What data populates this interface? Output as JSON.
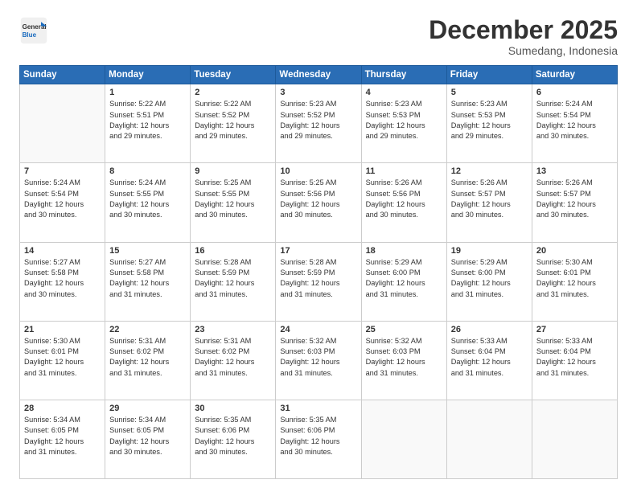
{
  "logo": {
    "line1": "General",
    "line2": "Blue"
  },
  "title": "December 2025",
  "subtitle": "Sumedang, Indonesia",
  "days_header": [
    "Sunday",
    "Monday",
    "Tuesday",
    "Wednesday",
    "Thursday",
    "Friday",
    "Saturday"
  ],
  "weeks": [
    [
      {
        "num": "",
        "info": ""
      },
      {
        "num": "1",
        "info": "Sunrise: 5:22 AM\nSunset: 5:51 PM\nDaylight: 12 hours\nand 29 minutes."
      },
      {
        "num": "2",
        "info": "Sunrise: 5:22 AM\nSunset: 5:52 PM\nDaylight: 12 hours\nand 29 minutes."
      },
      {
        "num": "3",
        "info": "Sunrise: 5:23 AM\nSunset: 5:52 PM\nDaylight: 12 hours\nand 29 minutes."
      },
      {
        "num": "4",
        "info": "Sunrise: 5:23 AM\nSunset: 5:53 PM\nDaylight: 12 hours\nand 29 minutes."
      },
      {
        "num": "5",
        "info": "Sunrise: 5:23 AM\nSunset: 5:53 PM\nDaylight: 12 hours\nand 29 minutes."
      },
      {
        "num": "6",
        "info": "Sunrise: 5:24 AM\nSunset: 5:54 PM\nDaylight: 12 hours\nand 30 minutes."
      }
    ],
    [
      {
        "num": "7",
        "info": "Sunrise: 5:24 AM\nSunset: 5:54 PM\nDaylight: 12 hours\nand 30 minutes."
      },
      {
        "num": "8",
        "info": "Sunrise: 5:24 AM\nSunset: 5:55 PM\nDaylight: 12 hours\nand 30 minutes."
      },
      {
        "num": "9",
        "info": "Sunrise: 5:25 AM\nSunset: 5:55 PM\nDaylight: 12 hours\nand 30 minutes."
      },
      {
        "num": "10",
        "info": "Sunrise: 5:25 AM\nSunset: 5:56 PM\nDaylight: 12 hours\nand 30 minutes."
      },
      {
        "num": "11",
        "info": "Sunrise: 5:26 AM\nSunset: 5:56 PM\nDaylight: 12 hours\nand 30 minutes."
      },
      {
        "num": "12",
        "info": "Sunrise: 5:26 AM\nSunset: 5:57 PM\nDaylight: 12 hours\nand 30 minutes."
      },
      {
        "num": "13",
        "info": "Sunrise: 5:26 AM\nSunset: 5:57 PM\nDaylight: 12 hours\nand 30 minutes."
      }
    ],
    [
      {
        "num": "14",
        "info": "Sunrise: 5:27 AM\nSunset: 5:58 PM\nDaylight: 12 hours\nand 30 minutes."
      },
      {
        "num": "15",
        "info": "Sunrise: 5:27 AM\nSunset: 5:58 PM\nDaylight: 12 hours\nand 31 minutes."
      },
      {
        "num": "16",
        "info": "Sunrise: 5:28 AM\nSunset: 5:59 PM\nDaylight: 12 hours\nand 31 minutes."
      },
      {
        "num": "17",
        "info": "Sunrise: 5:28 AM\nSunset: 5:59 PM\nDaylight: 12 hours\nand 31 minutes."
      },
      {
        "num": "18",
        "info": "Sunrise: 5:29 AM\nSunset: 6:00 PM\nDaylight: 12 hours\nand 31 minutes."
      },
      {
        "num": "19",
        "info": "Sunrise: 5:29 AM\nSunset: 6:00 PM\nDaylight: 12 hours\nand 31 minutes."
      },
      {
        "num": "20",
        "info": "Sunrise: 5:30 AM\nSunset: 6:01 PM\nDaylight: 12 hours\nand 31 minutes."
      }
    ],
    [
      {
        "num": "21",
        "info": "Sunrise: 5:30 AM\nSunset: 6:01 PM\nDaylight: 12 hours\nand 31 minutes."
      },
      {
        "num": "22",
        "info": "Sunrise: 5:31 AM\nSunset: 6:02 PM\nDaylight: 12 hours\nand 31 minutes."
      },
      {
        "num": "23",
        "info": "Sunrise: 5:31 AM\nSunset: 6:02 PM\nDaylight: 12 hours\nand 31 minutes."
      },
      {
        "num": "24",
        "info": "Sunrise: 5:32 AM\nSunset: 6:03 PM\nDaylight: 12 hours\nand 31 minutes."
      },
      {
        "num": "25",
        "info": "Sunrise: 5:32 AM\nSunset: 6:03 PM\nDaylight: 12 hours\nand 31 minutes."
      },
      {
        "num": "26",
        "info": "Sunrise: 5:33 AM\nSunset: 6:04 PM\nDaylight: 12 hours\nand 31 minutes."
      },
      {
        "num": "27",
        "info": "Sunrise: 5:33 AM\nSunset: 6:04 PM\nDaylight: 12 hours\nand 31 minutes."
      }
    ],
    [
      {
        "num": "28",
        "info": "Sunrise: 5:34 AM\nSunset: 6:05 PM\nDaylight: 12 hours\nand 31 minutes."
      },
      {
        "num": "29",
        "info": "Sunrise: 5:34 AM\nSunset: 6:05 PM\nDaylight: 12 hours\nand 30 minutes."
      },
      {
        "num": "30",
        "info": "Sunrise: 5:35 AM\nSunset: 6:06 PM\nDaylight: 12 hours\nand 30 minutes."
      },
      {
        "num": "31",
        "info": "Sunrise: 5:35 AM\nSunset: 6:06 PM\nDaylight: 12 hours\nand 30 minutes."
      },
      {
        "num": "",
        "info": ""
      },
      {
        "num": "",
        "info": ""
      },
      {
        "num": "",
        "info": ""
      }
    ]
  ]
}
